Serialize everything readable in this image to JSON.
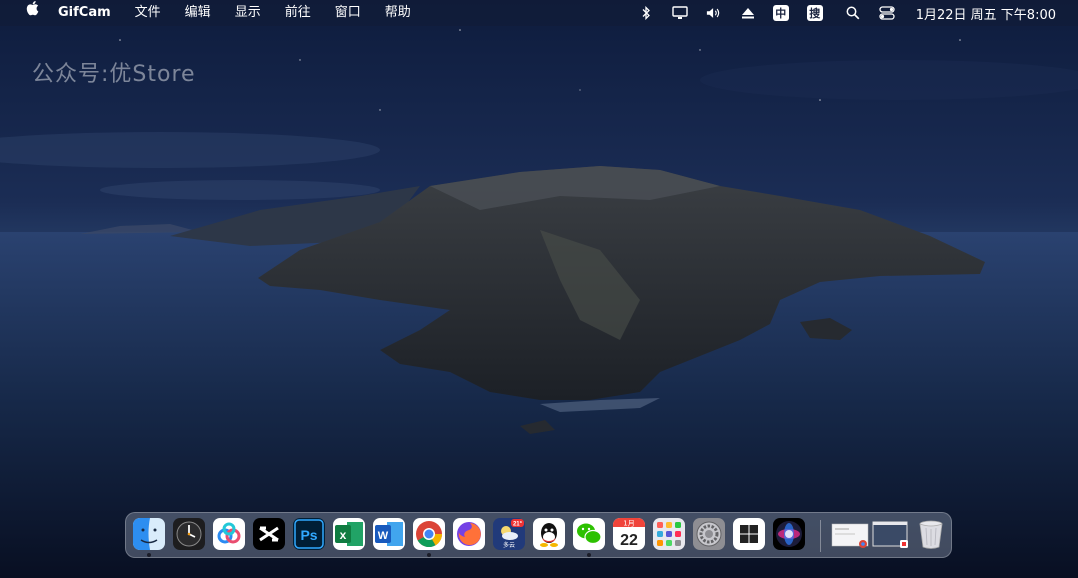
{
  "watermark": "公众号:优Store",
  "menubar": {
    "apple_icon": "apple-icon",
    "app_name": "GifCam",
    "menus": [
      "文件",
      "编辑",
      "显示",
      "前往",
      "窗口",
      "帮助"
    ],
    "status_icons": [
      "bluetooth-icon",
      "display-icon",
      "volume-icon",
      "eject-icon"
    ],
    "ime_label": "中",
    "sogou_label": "搜",
    "clock": "1月22日 周五 下午8:00"
  },
  "dock": {
    "apps": [
      {
        "name": "finder",
        "running": true
      },
      {
        "name": "clock"
      },
      {
        "name": "baidu-netdisk"
      },
      {
        "name": "capcut"
      },
      {
        "name": "photoshop",
        "label": "Ps"
      },
      {
        "name": "excel",
        "label": "x"
      },
      {
        "name": "word",
        "label": "W"
      },
      {
        "name": "chrome",
        "running": true
      },
      {
        "name": "firefox"
      },
      {
        "name": "weather",
        "badge": "21°",
        "sub": "多云"
      },
      {
        "name": "qq"
      },
      {
        "name": "wechat",
        "running": true
      },
      {
        "name": "calendar",
        "month": "1月",
        "day": "22"
      },
      {
        "name": "launchpad"
      },
      {
        "name": "system-preferences"
      },
      {
        "name": "windows"
      },
      {
        "name": "siri"
      }
    ],
    "trash_icon": "trash-icon"
  },
  "colors": {
    "sky_top": "#0d1a3a",
    "sea": "#16264a",
    "island": "#2a2f33",
    "menubar_text": "#ffffff"
  }
}
